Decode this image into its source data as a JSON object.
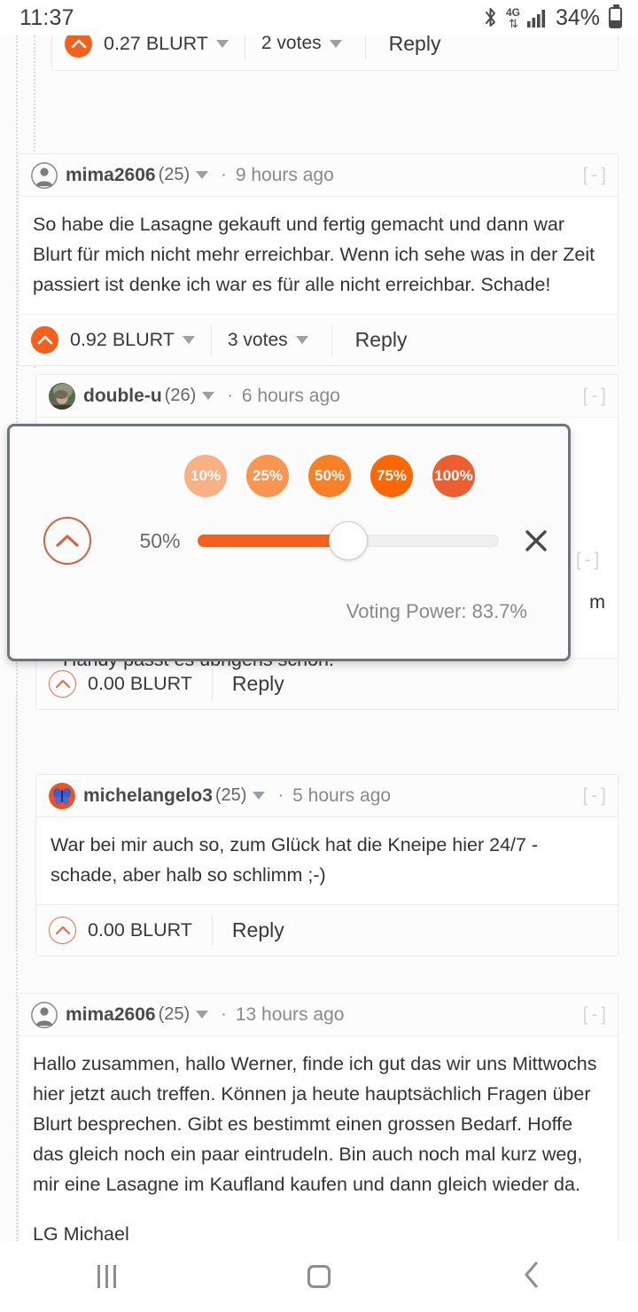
{
  "statusbar": {
    "time": "11:37",
    "battery_percent": "34%",
    "network": "4G",
    "icons": [
      "bluetooth-icon",
      "data-transfer-icon",
      "signal-bars-icon",
      "battery-icon"
    ]
  },
  "comments": [
    {
      "id": "comment-partial-top",
      "payout": "0.27 BLURT",
      "votes": "2 votes",
      "reply": "Reply",
      "upvote_state": "filled"
    },
    {
      "id": "comment-mima2606-9h",
      "author": "mima2606",
      "reputation": "(25)",
      "separator": "·",
      "age": "9 hours ago",
      "collapse": "[ - ]",
      "avatar": "default-person-avatar",
      "body": [
        "So habe die Lasagne gekauft und fertig gemacht und dann war Blurt für mich nicht mehr erreichbar. Wenn ich sehe was in der Zeit passiert ist denke ich war es für alle nicht erreichbar. Schade!"
      ],
      "payout": "0.92 BLURT",
      "votes": "3 votes",
      "reply": "Reply",
      "upvote_state": "filled"
    },
    {
      "id": "comment-double-u-6h",
      "author": "double-u",
      "reputation": "(26)",
      "separator": "·",
      "age": "6 hours ago",
      "collapse": "[ - ]",
      "avatar": "photo-avatar",
      "body_visible_tail": "Handy passt es übrigens schon.",
      "body_clipped_fragment": "m",
      "payout": "0.00 BLURT",
      "reply": "Reply",
      "upvote_state": "outline"
    },
    {
      "id": "comment-hidden-behind-popup",
      "collapse": "[ - ]"
    },
    {
      "id": "comment-michelangelo3-5h",
      "author": "michelangelo3",
      "reputation": "(25)",
      "separator": "·",
      "age": "5 hours ago",
      "collapse": "[ - ]",
      "avatar": "butterfly-avatar",
      "body": [
        "War bei mir auch so, zum Glück hat die Kneipe hier 24/7 - schade, aber halb so schlimm ;-)"
      ],
      "payout": "0.00 BLURT",
      "reply": "Reply",
      "upvote_state": "outline"
    },
    {
      "id": "comment-mima2606-13h",
      "author": "mima2606",
      "reputation": "(25)",
      "separator": "·",
      "age": "13 hours ago",
      "collapse": "[ - ]",
      "avatar": "default-person-avatar",
      "body": [
        "Hallo zusammen, hallo Werner, finde ich gut das wir uns Mittwochs hier jetzt auch treffen. Können ja heute hauptsächlich Fragen über Blurt besprechen. Gibt es bestimmt einen grossen Bedarf. Hoffe das gleich noch ein paar eintrudeln. Bin auch noch mal kurz weg, mir eine Lasagne im Kaufland kaufen und dann gleich wieder da.",
        "LG Michael"
      ]
    }
  ],
  "vote_popup": {
    "presets": [
      {
        "label": "10%",
        "color": "#f9b183"
      },
      {
        "label": "25%",
        "color": "#f89550"
      },
      {
        "label": "50%",
        "color": "#fa8028"
      },
      {
        "label": "75%",
        "color": "#fb6705"
      },
      {
        "label": "100%",
        "color": "#ec5f32"
      }
    ],
    "slider_value_label": "50%",
    "slider_percent": 50,
    "voting_power": "Voting Power: 83.7%",
    "close_label": "✕",
    "upvote_icon": "chevron-up-icon",
    "fill_color": "#f4611d"
  },
  "navbar": {
    "recents": "recents-icon",
    "home": "home-icon",
    "back": "back-icon"
  },
  "theme": {
    "accent": "#f4611d",
    "accent_outline": "#e2714a",
    "text": "#333333",
    "muted": "#8a8a8a",
    "page_bg": "#fbfbfb"
  }
}
